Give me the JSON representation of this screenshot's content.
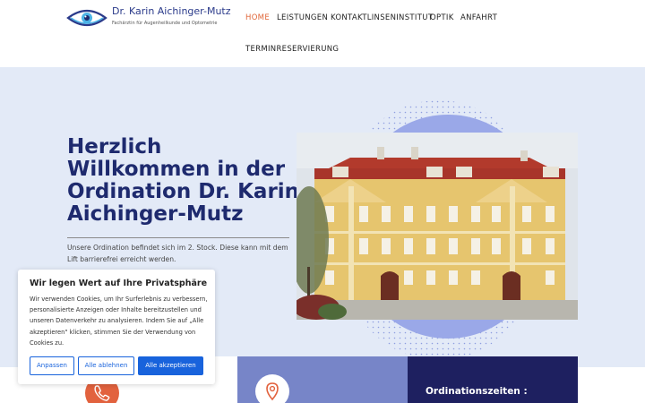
{
  "header": {
    "logo_title": "Dr. Karin Aichinger-Mutz",
    "logo_subtitle": "Fachärztin für Augenheilkunde und Optometrie",
    "nav": [
      {
        "label": "HOME",
        "active": true
      },
      {
        "label": "LEISTUNGEN",
        "active": false
      },
      {
        "label": "KONTAKTLINSENINSTITUT",
        "active": false
      },
      {
        "label": "OPTIK",
        "active": false
      },
      {
        "label": "ANFAHRT",
        "active": false
      },
      {
        "label": "TERMINRESERVIERUNG",
        "active": false
      }
    ]
  },
  "hero": {
    "title": "Herzlich Willkommen in der Ordination Dr. Karin Aichinger-Mutz",
    "text": "Unsere Ordination befindet sich im 2. Stock. Diese kann mit dem Lift barrierefrei erreicht werden."
  },
  "cards": {
    "hours_title": "Ordinationszeiten :"
  },
  "cookie": {
    "title": "Wir legen Wert auf Ihre Privatsphäre",
    "text": "Wir verwenden Cookies, um Ihr Surferlebnis zu verbessern, personalisierte Anzeigen oder Inhalte bereitzustellen und unseren Datenverkehr zu analysieren. Indem Sie auf „Alle akzeptieren\" klicken, stimmen Sie der Verwendung von Cookies zu.",
    "customize_label": "Anpassen",
    "reject_label": "Alle ablehnen",
    "accept_label": "Alle akzeptieren"
  },
  "colors": {
    "brand_navy": "#1e2a6e",
    "accent_orange": "#e0673a",
    "cookie_blue": "#1863dc",
    "hero_bg": "#e3eaf7"
  },
  "icons": [
    "eye-logo-icon",
    "phone-icon",
    "location-pin-icon"
  ]
}
